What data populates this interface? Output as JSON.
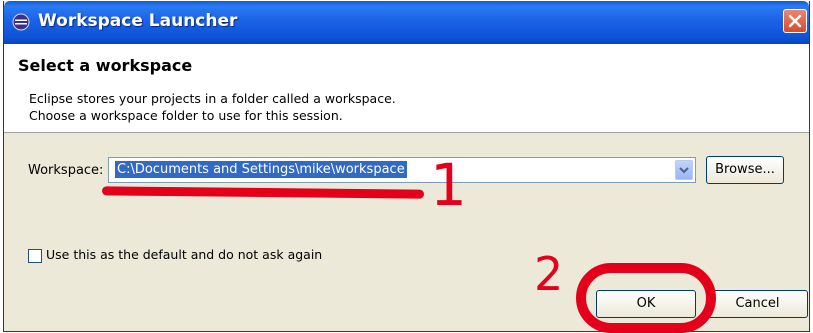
{
  "window": {
    "title": "Workspace Launcher",
    "icon": "eclipse-icon",
    "close_icon": "close-icon"
  },
  "header": {
    "title": "Select a workspace",
    "desc_line1": "Eclipse stores your projects in a folder called a workspace.",
    "desc_line2": "Choose a workspace folder to use for this session."
  },
  "workspace": {
    "label": "Workspace:",
    "value": "C:\\Documents and Settings\\mike\\workspace",
    "browse_label": "Browse..."
  },
  "default_option": {
    "label": "Use this as the default and do not ask again",
    "checked": false
  },
  "buttons": {
    "ok": "OK",
    "cancel": "Cancel"
  },
  "annotations": {
    "step1": "1",
    "step2": "2",
    "color": "#e4001b"
  }
}
